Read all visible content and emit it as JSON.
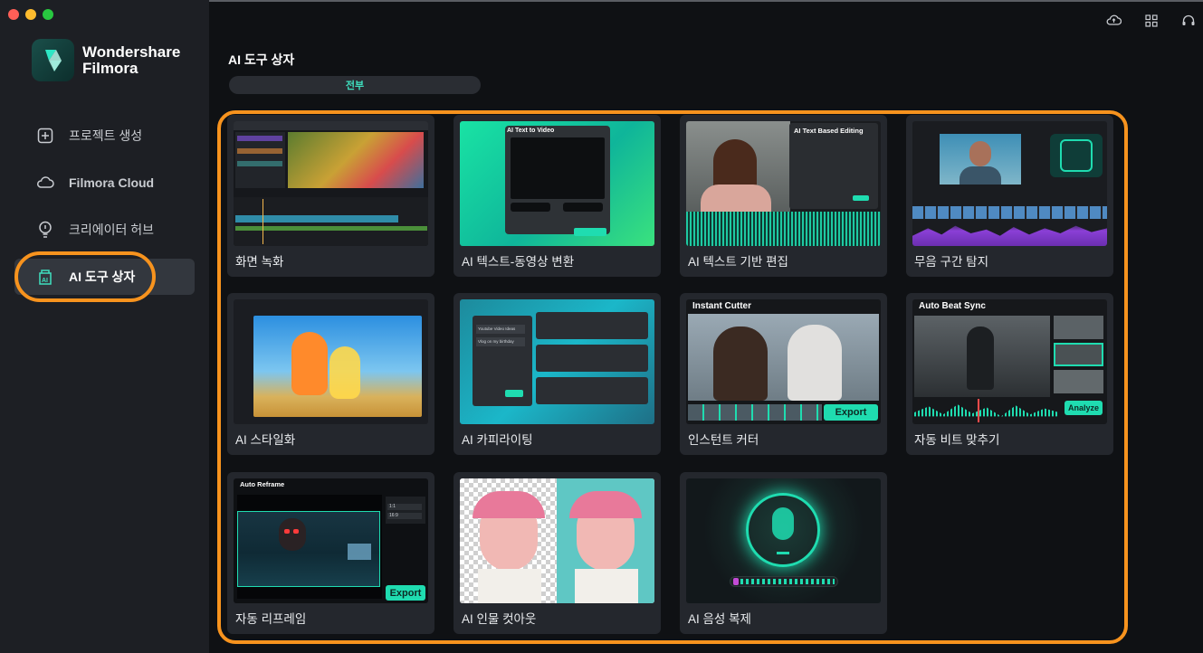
{
  "window": {
    "traffic_lights": [
      "close",
      "minimize",
      "maximize"
    ]
  },
  "brand": {
    "line1": "Wondershare",
    "line2": "Filmora"
  },
  "sidebar": {
    "items": [
      {
        "label": "프로젝트 생성",
        "icon": "plus-square-icon"
      },
      {
        "label": "Filmora Cloud",
        "icon": "cloud-icon"
      },
      {
        "label": "크리에이터 허브",
        "icon": "bulb-icon"
      },
      {
        "label": "AI 도구 상자",
        "icon": "ai-box-icon",
        "active": true
      }
    ]
  },
  "topbar": {
    "icons": [
      "cloud-upload-icon",
      "grid-icon",
      "headset-icon"
    ]
  },
  "main": {
    "title": "AI 도구 상자",
    "filter": "전부",
    "cards": [
      {
        "label": "화면 녹화"
      },
      {
        "label": "AI 텍스트-동영상 변환",
        "overlay": "AI Text to Video"
      },
      {
        "label": "AI 텍스트 기반 편집",
        "overlay": "AI Text Based Editing"
      },
      {
        "label": "무음 구간 탐지"
      },
      {
        "label": "AI 스타일화"
      },
      {
        "label": "AI 카피라이팅",
        "inputs": [
          "Youtube Video Ideas",
          "Vlog on my birthday"
        ]
      },
      {
        "label": "인스턴트 커터",
        "overlay": "Instant Cutter",
        "button": "Export"
      },
      {
        "label": "자동 비트 맞추기",
        "overlay": "Auto Beat Sync",
        "button": "Analyze"
      },
      {
        "label": "자동 리프레임",
        "overlay": "Auto Reframe",
        "button": "Export",
        "ratios": [
          "1:1",
          "16:9"
        ]
      },
      {
        "label": "AI 인물 컷아웃"
      },
      {
        "label": "AI 음성 복제"
      }
    ]
  },
  "colors": {
    "accent": "#1fdcb0",
    "highlight": "#f7931e",
    "sidebar_bg": "#1d1f24",
    "card_bg": "#24272d"
  }
}
